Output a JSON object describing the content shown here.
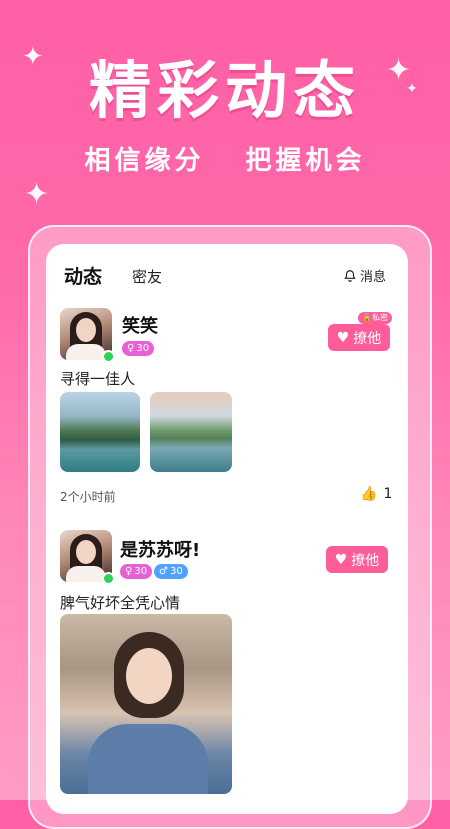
{
  "hero": {
    "title": "精彩动态",
    "subtitle_left": "相信缘分",
    "subtitle_right": "把握机会"
  },
  "tabs": [
    {
      "label": "动态",
      "active": true
    },
    {
      "label": "密友",
      "active": false
    }
  ],
  "messages": {
    "label": "消息",
    "icon": "bell-icon"
  },
  "posts": [
    {
      "name": "笑笑",
      "badges": [
        {
          "text": "30",
          "color": "#e760d6",
          "icon": "female-icon"
        }
      ],
      "private_label": "私密",
      "chat_label": "撩他",
      "content": "寻得一佳人",
      "time": "2个小时前",
      "likes": "1",
      "online": true
    },
    {
      "name": "是苏苏呀!",
      "badges": [
        {
          "text": "30",
          "color": "#e760d6",
          "icon": "female-icon"
        },
        {
          "text": "30",
          "color": "#4fa3ff",
          "icon": "male-icon"
        }
      ],
      "chat_label": "撩他",
      "content": "脾气好坏全凭心情",
      "online": true
    }
  ],
  "colors": {
    "accent": "#ff5c9a",
    "online": "#2fd158"
  }
}
